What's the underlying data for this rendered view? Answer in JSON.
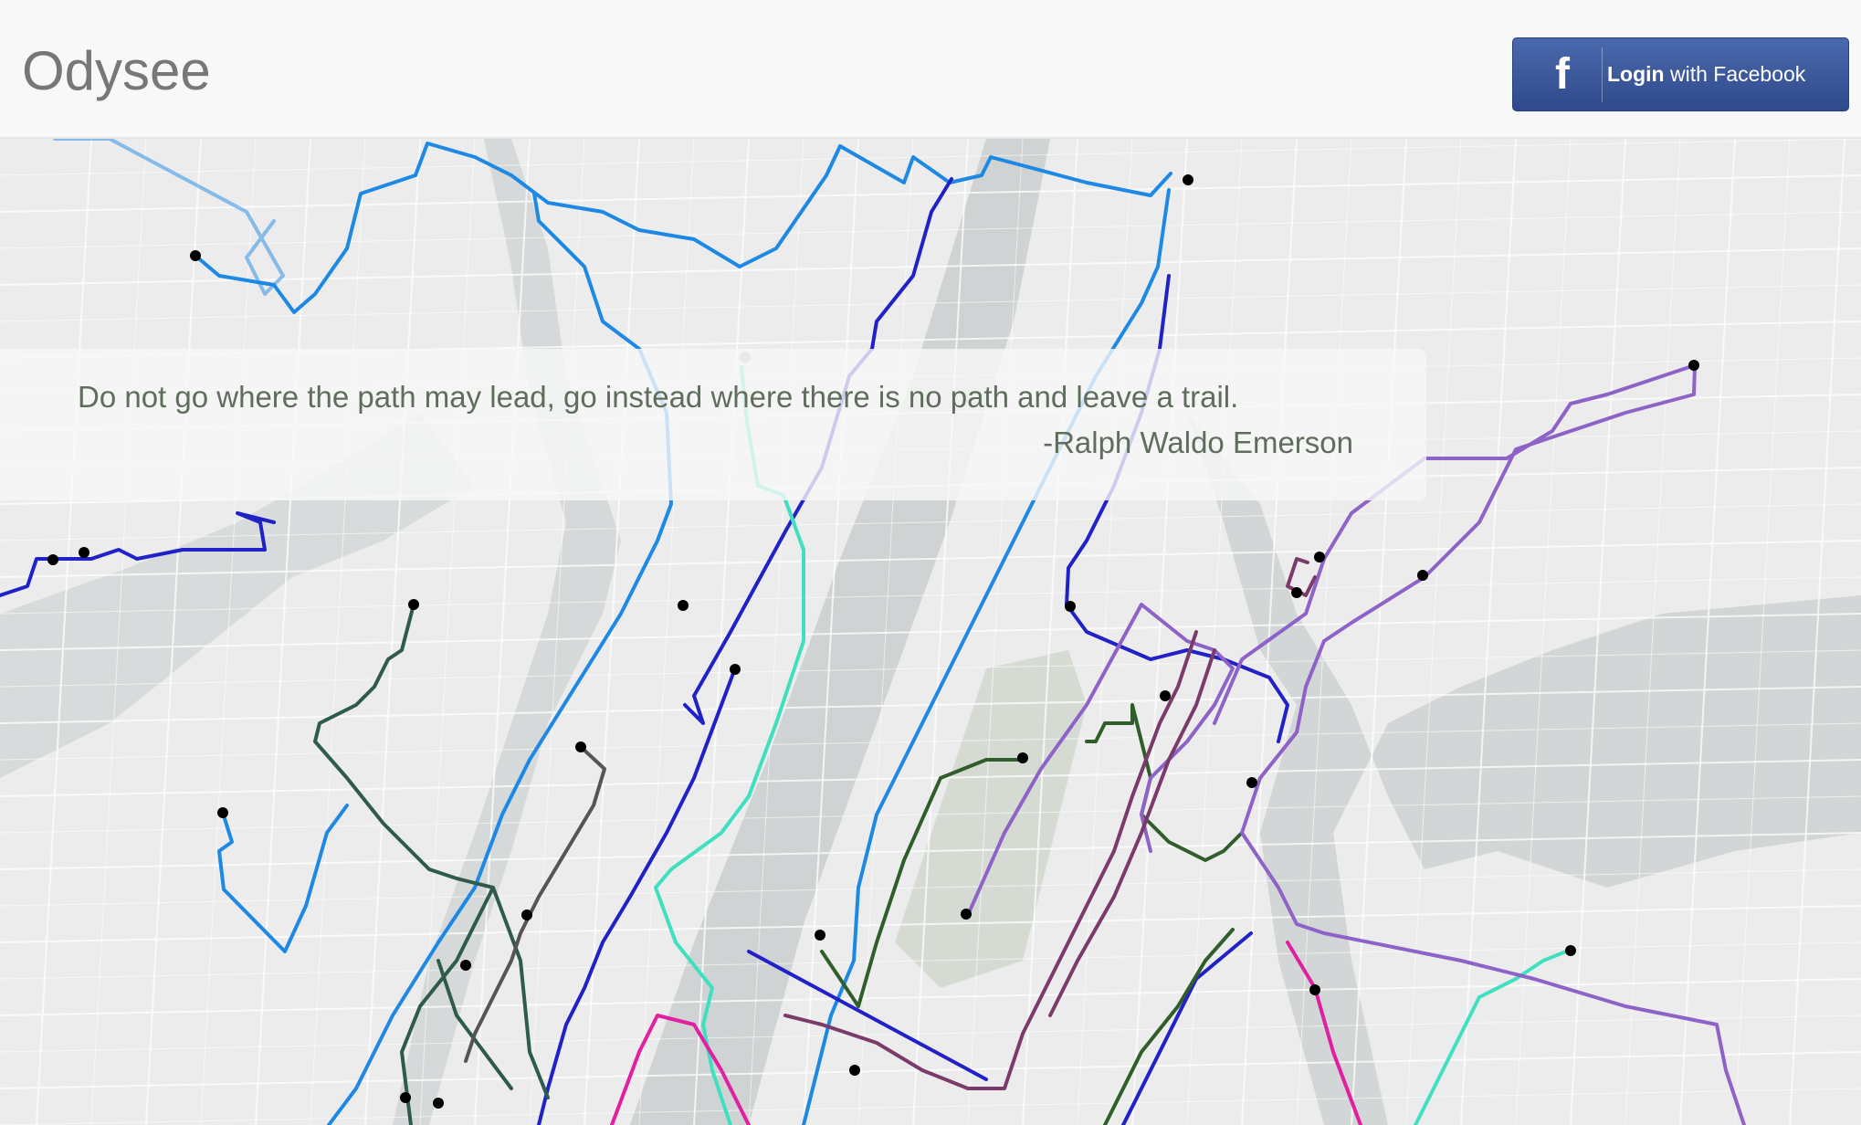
{
  "navbar": {
    "brand": "Odysee",
    "login_button": {
      "icon": "facebook-icon",
      "label_bold": "Login",
      "label_rest": " with Facebook",
      "color": "#3b5998"
    }
  },
  "quote": {
    "text": "Do not go where the path may lead, go instead where there is no path and leave a trail.",
    "author": "-Ralph Waldo Emerson"
  },
  "map": {
    "description_icon": "route-map",
    "route_colors": [
      "#1e88e5",
      "#2121c8",
      "#3fe0c0",
      "#2f5b4a",
      "#2f5e2a",
      "#8e63c8",
      "#7a3a6a",
      "#e020a0",
      "#555555"
    ]
  }
}
